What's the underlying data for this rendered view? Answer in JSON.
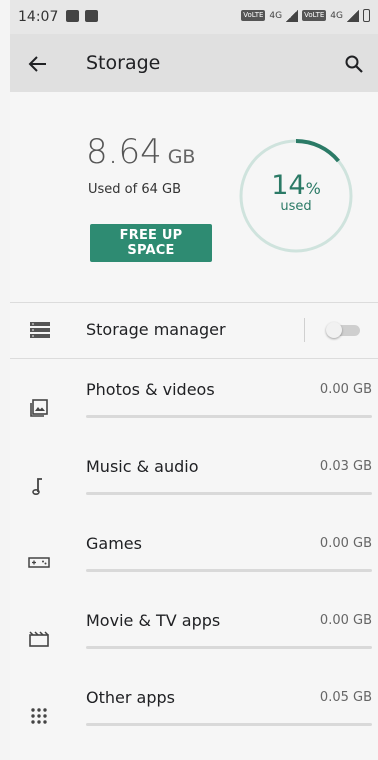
{
  "status_bar": {
    "time": "14:07",
    "network_1": "4G",
    "network_2": "4G",
    "volte_label": "VoLTE"
  },
  "app_bar": {
    "title": "Storage",
    "back_icon": "arrow-back-icon",
    "search_icon": "search-icon"
  },
  "summary": {
    "used_value": "8.64",
    "used_unit": "GB",
    "used_of": "Used of 64 GB",
    "free_up_button": "FREE UP SPACE",
    "percent_value": "14",
    "percent_sign": "%",
    "percent_caption": "used",
    "percent_fraction": 0.14,
    "accent_color": "#2e8b72"
  },
  "storage_manager": {
    "label": "Storage manager",
    "enabled": false,
    "icon": "storage-manager-icon"
  },
  "categories": [
    {
      "label": "Photos & videos",
      "size": "0.00 GB",
      "fraction": 0.0,
      "icon": "photos-icon"
    },
    {
      "label": "Music & audio",
      "size": "0.03 GB",
      "fraction": 0.0,
      "icon": "music-note-icon"
    },
    {
      "label": "Games",
      "size": "0.00 GB",
      "fraction": 0.0,
      "icon": "gamepad-icon"
    },
    {
      "label": "Movie & TV apps",
      "size": "0.00 GB",
      "fraction": 0.0,
      "icon": "movie-icon"
    },
    {
      "label": "Other apps",
      "size": "0.05 GB",
      "fraction": 0.0,
      "icon": "apps-grid-icon"
    }
  ]
}
